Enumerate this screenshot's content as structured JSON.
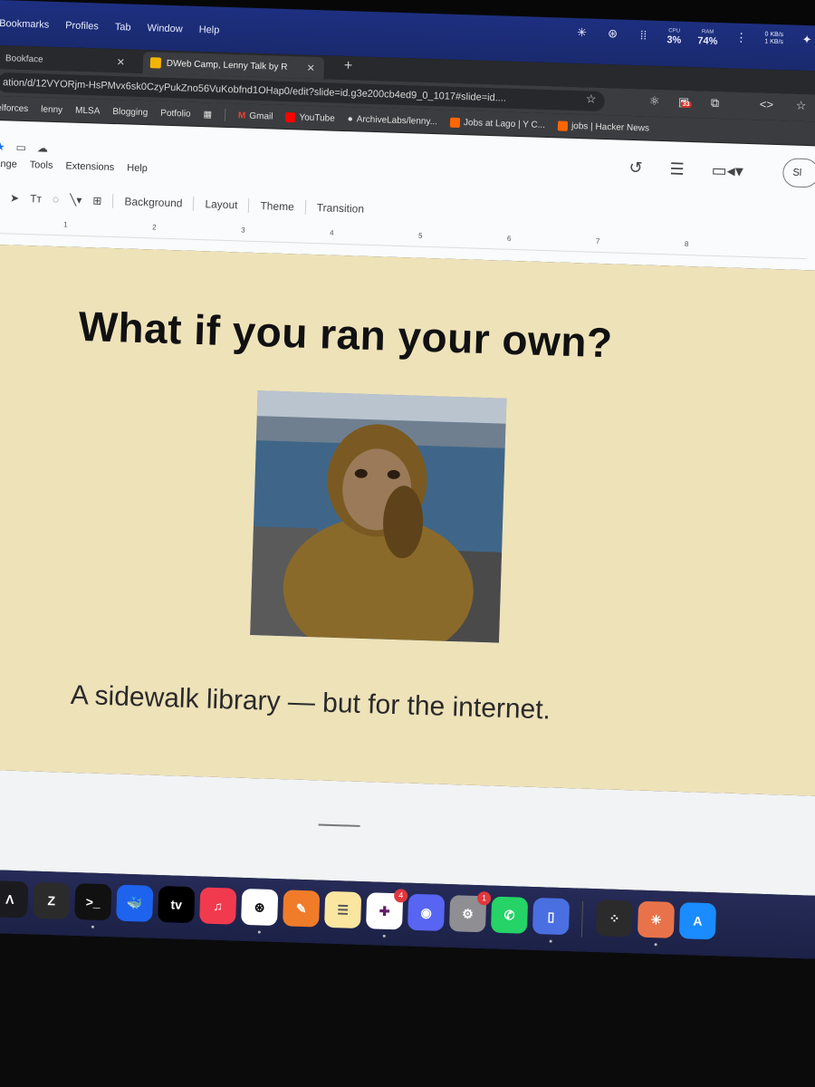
{
  "menubar": {
    "items": [
      "Bookmarks",
      "Profiles",
      "Tab",
      "Window",
      "Help"
    ],
    "cpu_label": "CPU",
    "cpu_value": "3%",
    "ram_label": "RAM",
    "ram_value": "74%",
    "net_down": "0 KB/s",
    "net_up": "1 KB/s"
  },
  "tabs": [
    {
      "label": "Bookface"
    },
    {
      "label": "DWeb Camp, Lenny Talk by R"
    }
  ],
  "address": {
    "url": "ation/d/12VYORjm-HsPMvx6sk0CzyPukZno56VuKobfnd1OHap0/edit?slide=id.g3e200cb4ed9_0_1017#slide=id....",
    "extension_badge": "33"
  },
  "bookmarks": [
    "elforces",
    "lenny",
    "MLSA",
    "Blogging",
    "Potfolio",
    "Gmail",
    "YouTube",
    "ArchiveLabs/lenny...",
    "Jobs at Lago | Y C...",
    "jobs | Hacker News"
  ],
  "slides": {
    "menus": [
      "ange",
      "Tools",
      "Extensions",
      "Help"
    ],
    "slideshow_label": "Sl",
    "toolbar": {
      "background": "Background",
      "layout": "Layout",
      "theme": "Theme",
      "transition": "Transition"
    },
    "ruler": [
      "1",
      "2",
      "3",
      "4",
      "5",
      "6",
      "7",
      "8"
    ]
  },
  "slide": {
    "title": "What if you ran your own?",
    "caption": "A sidewalk library — but for the internet.",
    "background_color": "#eee2b9"
  },
  "dock": {
    "apps": [
      "arc-icon",
      "zed-icon",
      "terminal-icon",
      "docker-icon",
      "apple-tv-icon",
      "music-icon",
      "chatgpt-icon",
      "pencil-icon",
      "notes-icon",
      "slack-icon",
      "discord-icon",
      "settings-icon",
      "whatsapp-icon",
      "simulator-icon",
      "launchpad-icon",
      "claude-icon",
      "app-store-icon"
    ],
    "tv_label": "tv",
    "slack_badge": "4",
    "settings_badge": "1"
  }
}
